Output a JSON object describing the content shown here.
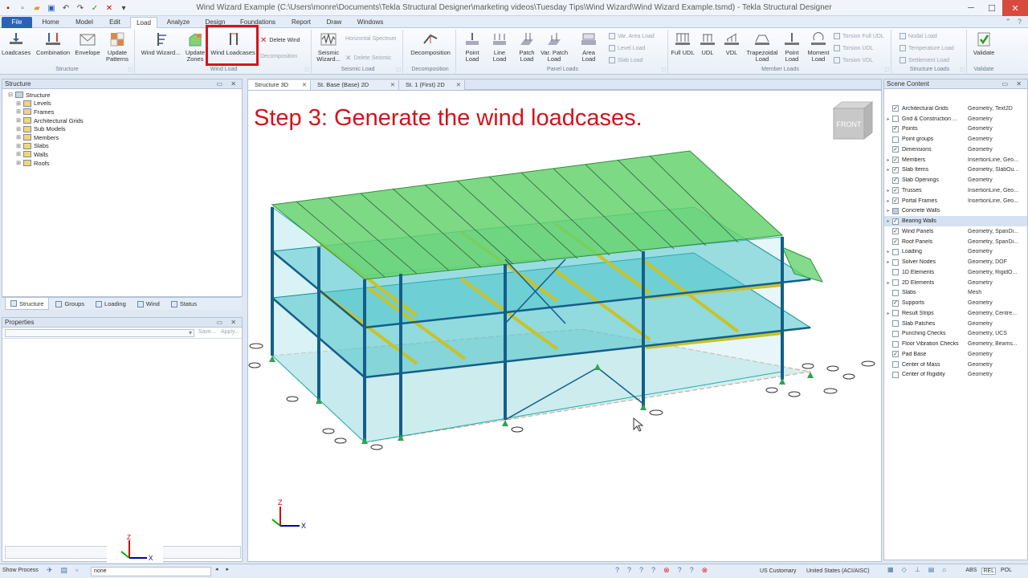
{
  "window": {
    "title": "Wind Wizard Example (C:\\Users\\monre\\Documents\\Tekla Structural Designer\\marketing videos\\Tuesday Tips\\Wind Wizard\\Wind Wizard Example.tsmd) - Tekla Structural Designer"
  },
  "tabs": [
    "File",
    "Home",
    "Model",
    "Edit",
    "Load",
    "Analyze",
    "Design",
    "Foundations",
    "Report",
    "Draw",
    "Windows"
  ],
  "ribbon": {
    "groups": {
      "structure": "Structure",
      "wind_load": "Wind Load",
      "seismic_load": "Seismic Load",
      "decomposition": "Decomposition",
      "panel_loads": "Panel Loads",
      "member_loads": "Member Loads",
      "structure_loads": "Structure Loads",
      "validate": "Validate"
    },
    "buttons": {
      "loadcases": "Loadcases",
      "combination": "Combination",
      "envelope": "Envelope",
      "update_patterns": "Update Patterns",
      "wind_wizard": "Wind Wizard...",
      "update_zones": "Update Zones",
      "wind_loadcases": "Wind Loadcases",
      "delete_wind": "Delete Wind",
      "decomposition_small": "Decomposition",
      "seismic_wizard": "Seismic Wizard...",
      "horizontal_spectrum": "Horizontal Spectrum",
      "delete_seismic": "Delete Seismic",
      "decomposition": "Decomposition",
      "point_load": "Point Load",
      "line_load": "Line Load",
      "patch_load": "Patch Load",
      "var_patch_load": "Var. Patch Load",
      "area_load": "Area Load",
      "var_area_load": "Var. Area Load",
      "level_load": "Level Load",
      "slab_load": "Slab Load",
      "full_udl": "Full UDL",
      "udl": "UDL",
      "vdl": "VDL",
      "trapezoidal_load": "Trapezoidal Load",
      "member_point_load": "Point Load",
      "moment_load": "Moment Load",
      "torsion_full_udl": "Torsion Full UDL",
      "torsion_udl": "Torsion UDL",
      "torsion_vdl": "Torsion VDL",
      "nodal_load": "Nodal Load",
      "temperature_load": "Temperature Load",
      "settlement_load": "Settlement Load",
      "validate": "Validate"
    }
  },
  "structure_panel": {
    "title": "Structure",
    "tree": [
      "Structure",
      "Levels",
      "Frames",
      "Architectural Grids",
      "Sub Models",
      "Members",
      "Slabs",
      "Walls",
      "Roofs"
    ],
    "bottom_tabs": [
      "Structure",
      "Groups",
      "Loading",
      "Wind",
      "Status"
    ]
  },
  "properties_panel": {
    "title": "Properties",
    "save": "Save...",
    "apply": "Apply..."
  },
  "view_tabs": [
    "Structure 3D",
    "St. Base (Base) 2D",
    "St. 1 (First) 2D"
  ],
  "view": {
    "caption": "Step 3: Generate the wind loadcases.",
    "cube_label": "FRONT",
    "axes": {
      "z": "Z",
      "x": "X"
    }
  },
  "scene_content": {
    "title": "Scene Content",
    "rows": [
      {
        "name": "Architectural Grids",
        "value": "Geometry, Text2D",
        "checked": "yes",
        "expand": false
      },
      {
        "name": "Grid & Construction ...",
        "value": "Geometry",
        "checked": "no",
        "expand": true
      },
      {
        "name": "Points",
        "value": "Geometry",
        "checked": "yes",
        "expand": false
      },
      {
        "name": "Point groups",
        "value": "Geometry",
        "checked": "no",
        "expand": false
      },
      {
        "name": "Dimensions",
        "value": "Geometry",
        "checked": "yes",
        "expand": false
      },
      {
        "name": "Members",
        "value": "InsertionLine, Geo...",
        "checked": "yes",
        "expand": true
      },
      {
        "name": "Slab Items",
        "value": "Geometry, SlabOu...",
        "checked": "yes",
        "expand": true
      },
      {
        "name": "Slab Openings",
        "value": "Geometry",
        "checked": "yes",
        "expand": false
      },
      {
        "name": "Trusses",
        "value": "InsertionLine, Geo...",
        "checked": "yes",
        "expand": true
      },
      {
        "name": "Portal Frames",
        "value": "InsertionLine, Geo...",
        "checked": "yes",
        "expand": true
      },
      {
        "name": "Concrete Walls",
        "value": "",
        "checked": "partial",
        "expand": true
      },
      {
        "name": "Bearing Walls",
        "value": "",
        "checked": "yes",
        "expand": true,
        "selected": true
      },
      {
        "name": "Wind Panels",
        "value": "Geometry, SpanDi...",
        "checked": "yes",
        "expand": false
      },
      {
        "name": "Roof Panels",
        "value": "Geometry, SpanDi...",
        "checked": "yes",
        "expand": false
      },
      {
        "name": "Loading",
        "value": "Geometry",
        "checked": "no",
        "expand": true
      },
      {
        "name": "Solver Nodes",
        "value": "Geometry, DOF",
        "checked": "no",
        "expand": true
      },
      {
        "name": "1D Elements",
        "value": "Geometry, RigidO...",
        "checked": "no",
        "expand": false
      },
      {
        "name": "2D Elements",
        "value": "Geometry",
        "checked": "no",
        "expand": true
      },
      {
        "name": "Slabs",
        "value": "Mesh",
        "checked": "no",
        "expand": false
      },
      {
        "name": "Supports",
        "value": "Geometry",
        "checked": "yes",
        "expand": false
      },
      {
        "name": "Result Strips",
        "value": "Geometry, Centre...",
        "checked": "no",
        "expand": true
      },
      {
        "name": "Slab Patches",
        "value": "Geometry",
        "checked": "no",
        "expand": false
      },
      {
        "name": "Punching Checks",
        "value": "Geometry, UCS",
        "checked": "no",
        "expand": false
      },
      {
        "name": "Floor Vibration Checks",
        "value": "Geometry, Beams...",
        "checked": "no",
        "expand": false
      },
      {
        "name": "Pad Base",
        "value": "Geometry",
        "checked": "yes",
        "expand": false
      },
      {
        "name": "Center of Mass",
        "value": "Geometry",
        "checked": "no",
        "expand": false
      },
      {
        "name": "Center of Rigidity",
        "value": "Geometry",
        "checked": "no",
        "expand": false
      }
    ]
  },
  "status": {
    "left": "Show Process",
    "input": "none",
    "units": "US Customary",
    "code": "United States (ACI/AISC)",
    "modes": [
      "ABS",
      "REL",
      "POL"
    ]
  },
  "colors": {
    "accent": "#2b62b8",
    "highlight": "#d4141c",
    "slab": "#5fd17f",
    "frame": "#1aa9b8",
    "beam": "#d2c21e"
  }
}
